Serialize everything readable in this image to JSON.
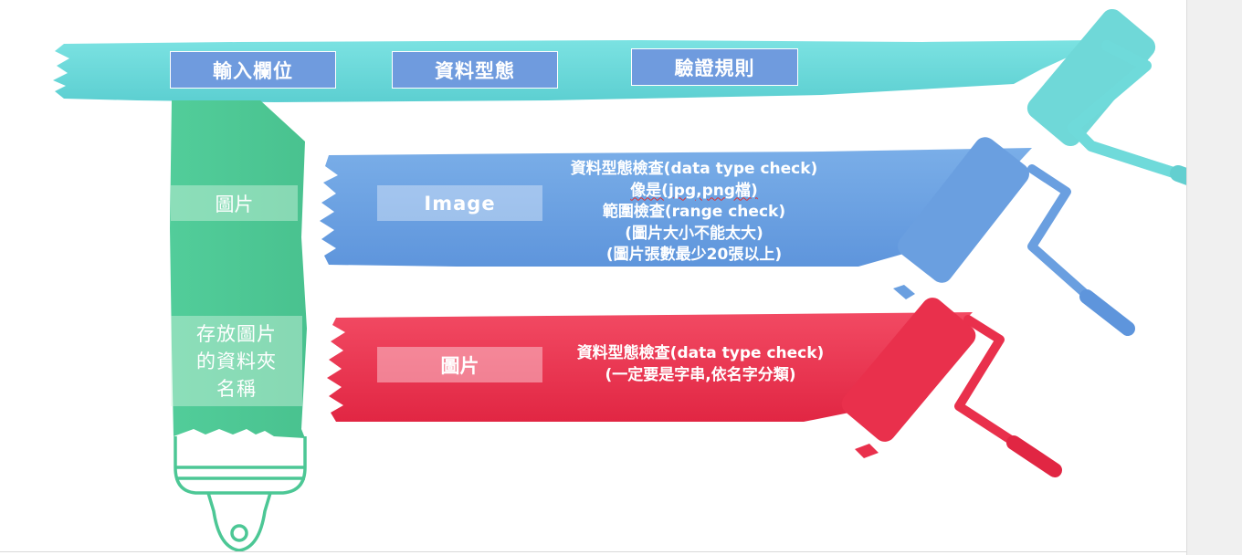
{
  "header": {
    "col1": "輸入欄位",
    "col2": "資料型態",
    "col3": "驗證規則"
  },
  "rows": [
    {
      "input_label": "圖片",
      "type_label": "Image",
      "rule_lines": [
        "資料型態檢查(data type check)",
        "像是(jpg,png檔)",
        "範圍檢查(range check)",
        "(圖片大小不能太大)",
        "(圖片張數最少20張以上)"
      ]
    },
    {
      "input_label_lines": [
        "存放圖片",
        "的資料夾",
        "名稱"
      ],
      "type_label": "圖片",
      "rule_lines": [
        "資料型態檢查(data type check)",
        "(一定要是字串,依名字分類)"
      ]
    }
  ],
  "colors": {
    "cyan": "#6fdada",
    "green": "#4cc795",
    "blue": "#6a9fe0",
    "red": "#e9304c"
  }
}
